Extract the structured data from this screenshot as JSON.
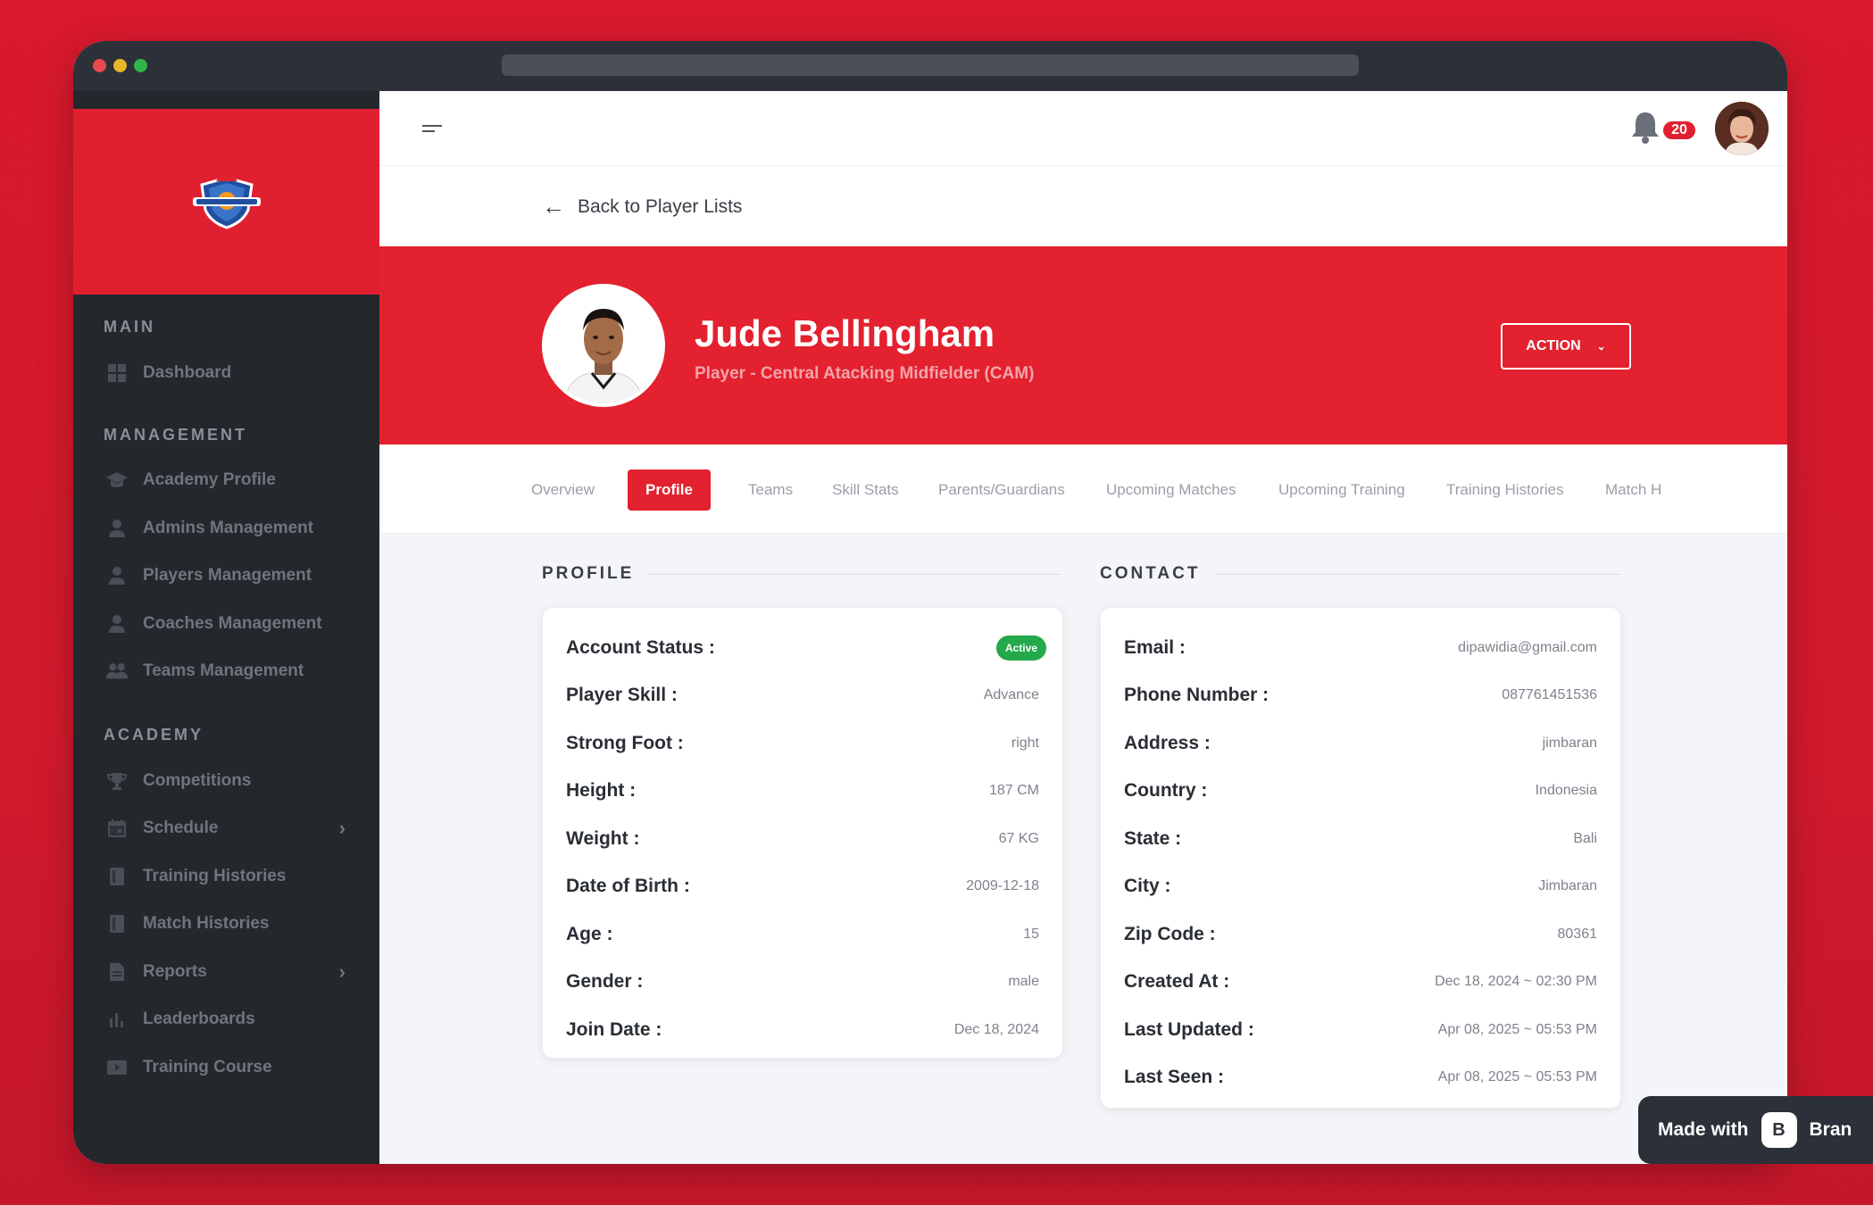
{
  "sidebar": {
    "sections": [
      {
        "title": "MAIN",
        "items": [
          {
            "label": "Dashboard",
            "icon": "grid-icon"
          }
        ]
      },
      {
        "title": "MANAGEMENT",
        "items": [
          {
            "label": "Academy Profile",
            "icon": "graduation-cap-icon"
          },
          {
            "label": "Admins Management",
            "icon": "user-icon"
          },
          {
            "label": "Players Management",
            "icon": "user-icon"
          },
          {
            "label": "Coaches Management",
            "icon": "user-icon"
          },
          {
            "label": "Teams Management",
            "icon": "users-icon"
          }
        ]
      },
      {
        "title": "ACADEMY",
        "items": [
          {
            "label": "Competitions",
            "icon": "trophy-icon"
          },
          {
            "label": "Schedule",
            "icon": "calendar-icon",
            "expandable": true
          },
          {
            "label": "Training Histories",
            "icon": "book-icon"
          },
          {
            "label": "Match Histories",
            "icon": "book-icon"
          },
          {
            "label": "Reports",
            "icon": "document-icon",
            "expandable": true
          },
          {
            "label": "Leaderboards",
            "icon": "bar-chart-icon"
          },
          {
            "label": "Training Course",
            "icon": "video-icon"
          }
        ]
      }
    ]
  },
  "topbar": {
    "notification_count": "20"
  },
  "back_link": {
    "label": "Back to Player Lists"
  },
  "player": {
    "name": "Jude Bellingham",
    "role": "Player - Central Atacking Midfielder (CAM)"
  },
  "action_button": {
    "label": "ACTION"
  },
  "tabs": [
    {
      "label": "Overview",
      "active": false
    },
    {
      "label": "Profile",
      "active": true
    },
    {
      "label": "Teams",
      "active": false
    },
    {
      "label": "Skill Stats",
      "active": false
    },
    {
      "label": "Parents/Guardians",
      "active": false
    },
    {
      "label": "Upcoming Matches",
      "active": false
    },
    {
      "label": "Upcoming Training",
      "active": false
    },
    {
      "label": "Training Histories",
      "active": false
    },
    {
      "label": "Match H",
      "active": false
    }
  ],
  "profile": {
    "title": "PROFILE",
    "status_label": "Account Status :",
    "status_value": "Active",
    "rows": [
      {
        "label": "Player Skill :",
        "value": "Advance"
      },
      {
        "label": "Strong Foot :",
        "value": "right"
      },
      {
        "label": "Height :",
        "value": "187 CM"
      },
      {
        "label": "Weight :",
        "value": "67 KG"
      },
      {
        "label": "Date of Birth :",
        "value": "2009-12-18"
      },
      {
        "label": "Age :",
        "value": "15"
      },
      {
        "label": "Gender :",
        "value": "male"
      },
      {
        "label": "Join Date :",
        "value": "Dec 18, 2024"
      }
    ]
  },
  "contact": {
    "title": "CONTACT",
    "rows": [
      {
        "label": "Email :",
        "value": "dipawidia@gmail.com"
      },
      {
        "label": "Phone Number :",
        "value": "087761451536"
      },
      {
        "label": "Address :",
        "value": "jimbaran"
      },
      {
        "label": "Country :",
        "value": "Indonesia"
      },
      {
        "label": "State :",
        "value": "Bali"
      },
      {
        "label": "City :",
        "value": "Jimbaran"
      },
      {
        "label": "Zip Code :",
        "value": "80361"
      },
      {
        "label": "Created At :",
        "value": "Dec 18, 2024 ~ 02:30 PM"
      },
      {
        "label": "Last Updated :",
        "value": "Apr 08, 2025 ~ 05:53 PM"
      },
      {
        "label": "Last Seen :",
        "value": "Apr 08, 2025 ~ 05:53 PM"
      }
    ]
  },
  "made_with": {
    "label": "Made with",
    "brand": "Bran"
  },
  "colors": {
    "brand_red": "#e3212f",
    "sidebar_bg": "#24272c",
    "status_green": "#23a84a"
  }
}
